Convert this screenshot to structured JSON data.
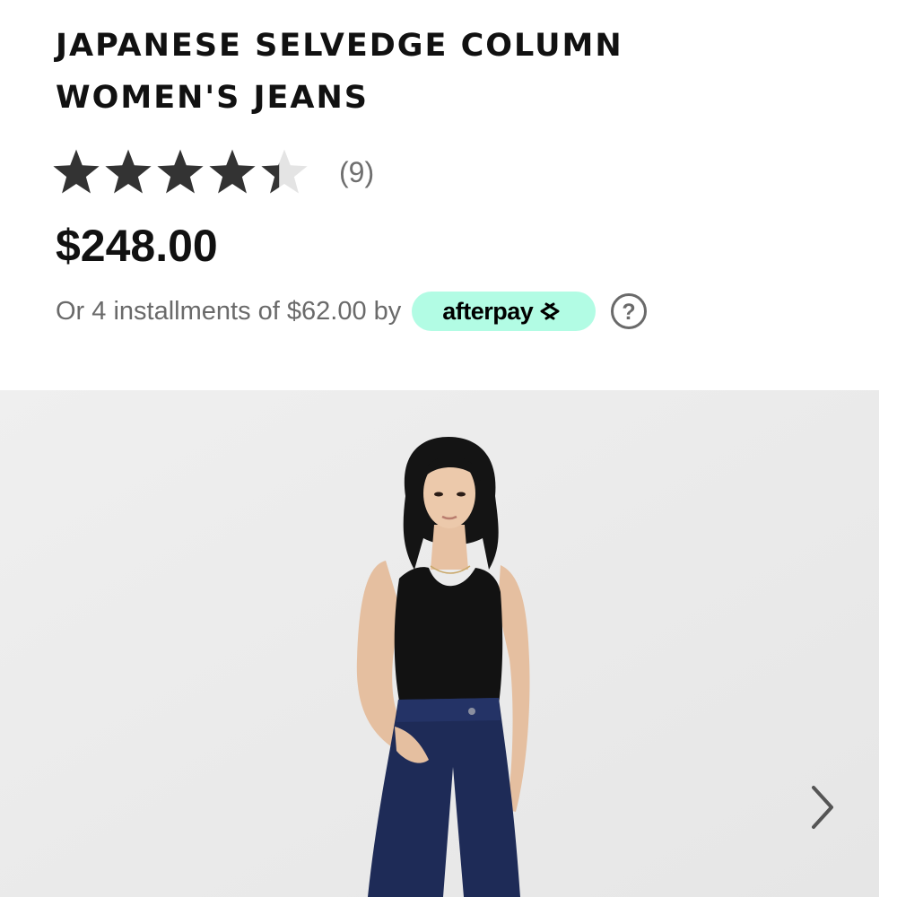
{
  "product": {
    "title": "JAPANESE SELVEDGE COLUMN WOMEN'S JEANS",
    "rating": {
      "value": 4.4,
      "max": 5,
      "count_label": "(9)"
    },
    "price": "$248.00"
  },
  "installments": {
    "text": "Or 4 installments of $62.00 by",
    "provider_label": "afterpay",
    "provider_icon": "afterpay-arrows-icon",
    "help_icon": "question-circle-icon"
  },
  "gallery": {
    "next_icon": "chevron-right-icon"
  },
  "colors": {
    "afterpay_mint": "#b2fce4",
    "star_filled": "#333333",
    "star_empty": "#e4e4e4",
    "gallery_bg": "#ececec",
    "denim": "#1e2b57"
  }
}
